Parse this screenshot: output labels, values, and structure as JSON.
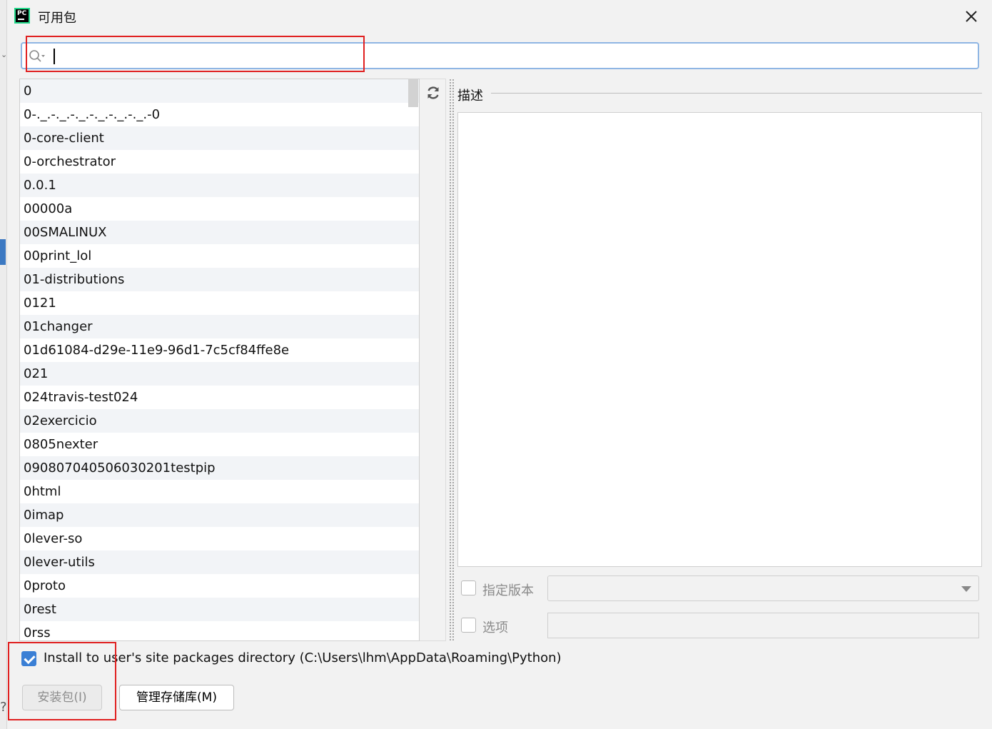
{
  "window": {
    "title": "可用包"
  },
  "search": {
    "value": "",
    "placeholder": ""
  },
  "packages": [
    "0",
    "0-._.-._.-._.-._.-._.-._.-0",
    "0-core-client",
    "0-orchestrator",
    "0.0.1",
    "00000a",
    "00SMALINUX",
    "00print_lol",
    "01-distributions",
    "0121",
    "01changer",
    "01d61084-d29e-11e9-96d1-7c5cf84ffe8e",
    "021",
    "024travis-test024",
    "02exercicio",
    "0805nexter",
    "090807040506030201testpip",
    "0html",
    "0imap",
    "0lever-so",
    "0lever-utils",
    "0proto",
    "0rest",
    "0rss"
  ],
  "description": {
    "label": "描述",
    "content": ""
  },
  "options": {
    "specify_version_label": "指定版本",
    "specify_version_checked": false,
    "version_value": "",
    "options_label": "选项",
    "options_checked": false,
    "options_value": ""
  },
  "install_to_user": {
    "label": "Install to user's site packages directory (C:\\Users\\lhm\\AppData\\Roaming\\Python)",
    "checked": true
  },
  "buttons": {
    "install": "安装包(I)",
    "manage_repos": "管理存储库(M)"
  },
  "colors": {
    "accent": "#3a7fd5",
    "highlight_box": "#e02020",
    "search_focus_border": "#8fb6e4"
  }
}
